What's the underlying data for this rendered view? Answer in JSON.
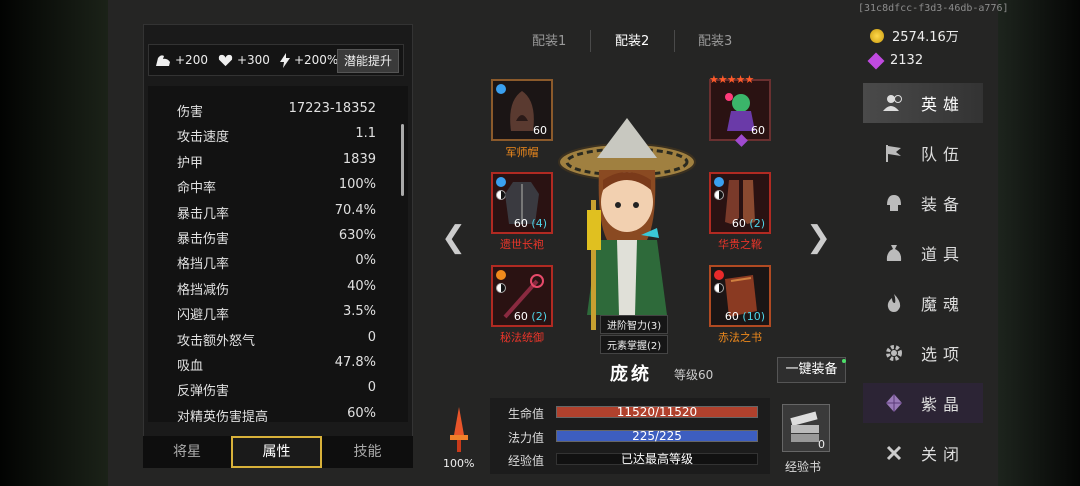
{
  "session_id": "[31c8dfcc-f3d3-46db-a776]",
  "bonus": {
    "strength": "+200",
    "health": "+300",
    "speed": "+200%",
    "potential_btn": "潜能提升"
  },
  "stats": [
    {
      "k": "伤害",
      "v": "17223-18352"
    },
    {
      "k": "攻击速度",
      "v": "1.1"
    },
    {
      "k": "护甲",
      "v": "1839"
    },
    {
      "k": "命中率",
      "v": "100%"
    },
    {
      "k": "暴击几率",
      "v": "70.4%"
    },
    {
      "k": "暴击伤害",
      "v": "630%"
    },
    {
      "k": "格挡几率",
      "v": "0%"
    },
    {
      "k": "格挡减伤",
      "v": "40%"
    },
    {
      "k": "闪避几率",
      "v": "3.5%"
    },
    {
      "k": "攻击额外怒气",
      "v": "0"
    },
    {
      "k": "吸血",
      "v": "47.8%"
    },
    {
      "k": "反弹伤害",
      "v": "0"
    },
    {
      "k": "对精英伤害提高",
      "v": "60%"
    }
  ],
  "tabs": {
    "stars": "将星",
    "attributes": "属性",
    "skills": "技能"
  },
  "loadouts": [
    "配装1",
    "配装2",
    "配装3"
  ],
  "items": {
    "hat": {
      "name": "军师帽",
      "level": "60",
      "plus": ""
    },
    "pet": {
      "name": "",
      "level": "60",
      "plus": ""
    },
    "robe": {
      "name": "遗世长袍",
      "level": "60",
      "plus": "(4)"
    },
    "boots": {
      "name": "华贵之靴",
      "level": "60",
      "plus": "(2)"
    },
    "weapon": {
      "name": "秘法统御",
      "level": "60",
      "plus": "(2)"
    },
    "book": {
      "name": "赤法之书",
      "level": "60",
      "plus": "(10)"
    }
  },
  "hero": {
    "name": "庞统",
    "level": "等级60",
    "tag1": "进阶智力(3)",
    "tag2": "元素掌握(2)"
  },
  "equip_all": "一键装备",
  "bars": {
    "hp_label": "生命值",
    "hp": "11520/11520",
    "hp_fraction": 1,
    "mp_label": "法力值",
    "mp": "225/225",
    "mp_fraction": 1,
    "xp_label": "经验值",
    "xp": "已达最高等级"
  },
  "rage_pct": "100%",
  "xp_book": {
    "label": "经验书",
    "count": "0"
  },
  "currency": {
    "gold": "2574.16万",
    "gems": "2132"
  },
  "menu": [
    "英雄",
    "队伍",
    "装备",
    "道具",
    "魔魂",
    "选项",
    "紫晶",
    "关闭"
  ],
  "colors": {
    "hp": "#b0412d",
    "mp": "#3d5ec0",
    "gold_border": "#d8b13a",
    "red_text": "#e8352a",
    "orange_text": "#f08a1c"
  }
}
